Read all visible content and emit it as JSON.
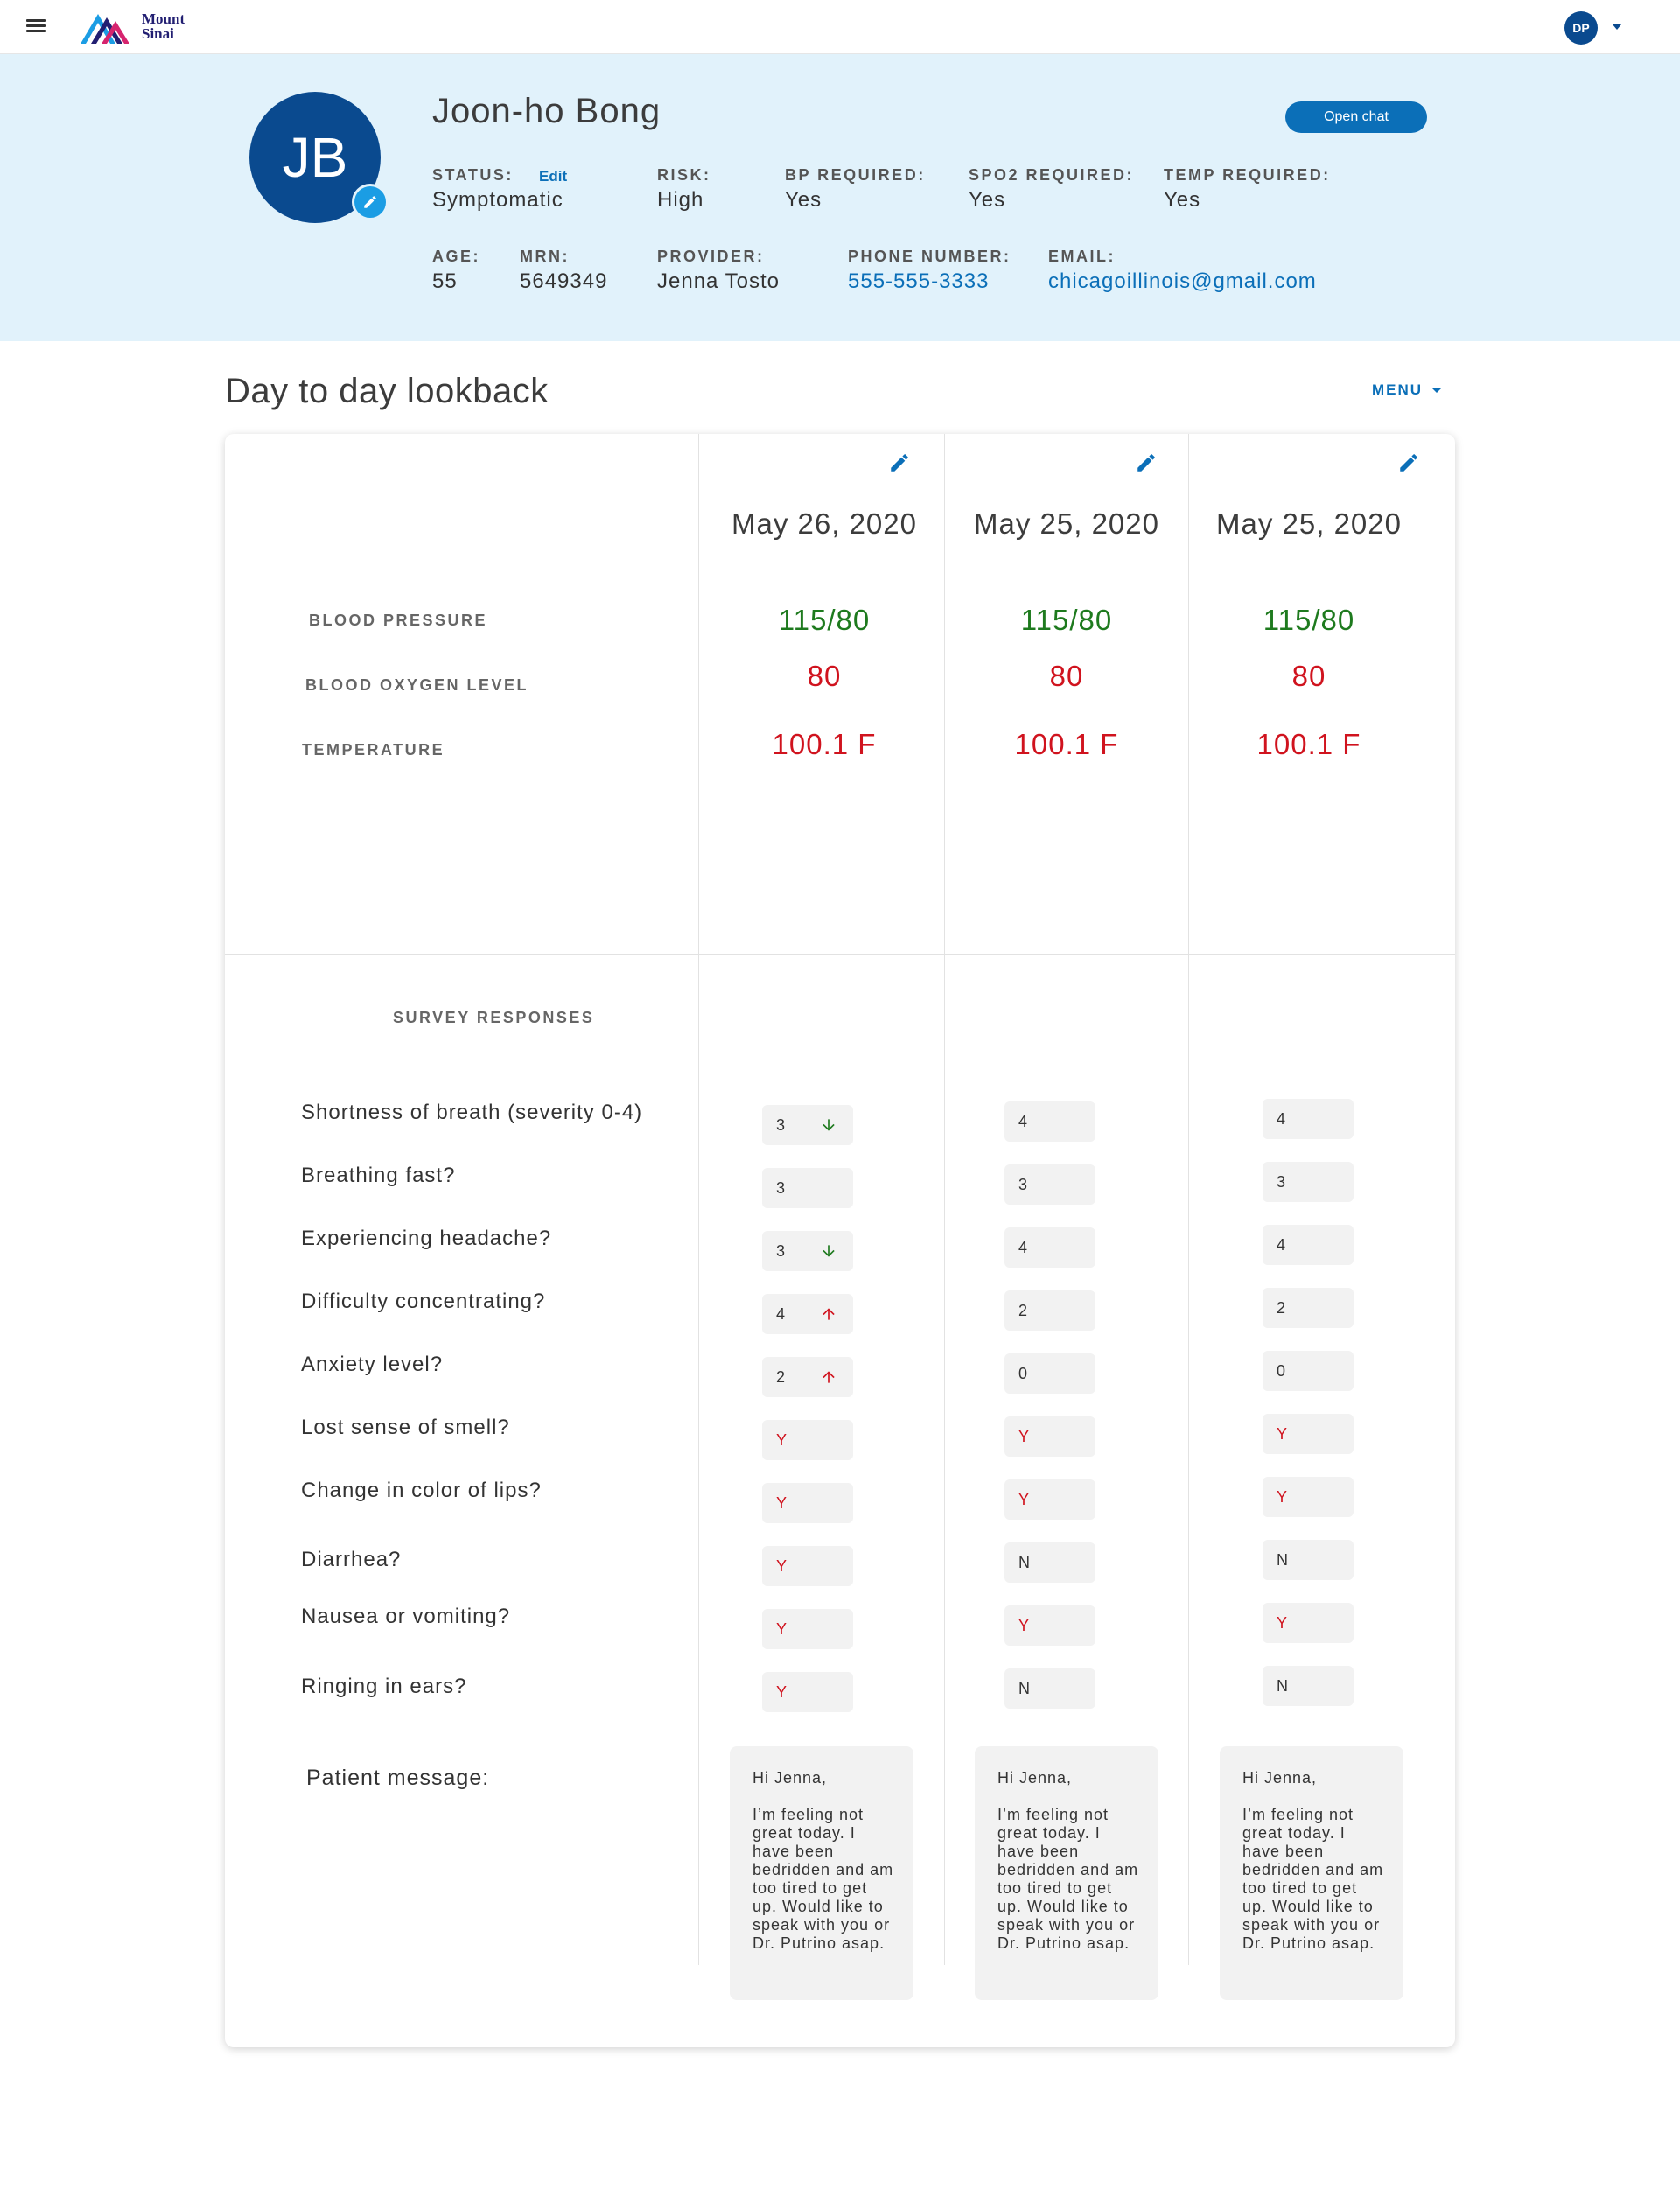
{
  "app": {
    "logo_line1": "Mount",
    "logo_line2": "Sinai",
    "user_initials": "DP"
  },
  "patient": {
    "initials": "JB",
    "name": "Joon-ho Bong",
    "open_chat_label": "Open chat",
    "edit_label": "Edit",
    "fields_row1": [
      {
        "label": "STATUS:",
        "value": "Symptomatic"
      },
      {
        "label": "RISK:",
        "value": "High"
      },
      {
        "label": "BP REQUIRED:",
        "value": "Yes"
      },
      {
        "label": "SPO2 REQUIRED:",
        "value": "Yes"
      },
      {
        "label": "TEMP REQUIRED:",
        "value": "Yes"
      }
    ],
    "fields_row2": [
      {
        "label": "AGE:",
        "value": "55"
      },
      {
        "label": "MRN:",
        "value": "5649349"
      },
      {
        "label": "PROVIDER:",
        "value": "Jenna Tosto"
      },
      {
        "label": "PHONE NUMBER:",
        "value": "555-555-3333"
      },
      {
        "label": "EMAIL:",
        "value": "chicagoillinois@gmail.com"
      }
    ]
  },
  "lookback": {
    "title": "Day to day lookback",
    "menu_label": "MENU",
    "vital_labels": [
      "BLOOD PRESSURE",
      "BLOOD OXYGEN LEVEL",
      "TEMPERATURE"
    ],
    "survey_title": "SURVEY RESPONSES",
    "questions": [
      "Shortness of breath (severity 0-4)",
      "Breathing fast?",
      "Experiencing headache?",
      "Difficulty concentrating?",
      "Anxiety level?",
      "Lost sense of smell?",
      "Change in color of lips?",
      "Diarrhea?",
      "Nausea or vomiting?",
      "Ringing in ears?"
    ],
    "message_label": "Patient message:",
    "days": [
      {
        "date": "May 26, 2020",
        "vitals": [
          "115/80",
          "80",
          "100.1 F"
        ],
        "responses": [
          "3",
          "3",
          "3",
          "4",
          "2",
          "Y",
          "Y",
          "Y",
          "Y",
          "Y"
        ],
        "trends": [
          "down",
          "",
          "down",
          "up",
          "up",
          "",
          "",
          "",
          "",
          ""
        ],
        "message": [
          "Hi Jenna,",
          "I’m feeling not great today. I have been bedridden and am too tired to get up. Would like to speak with you or Dr. Putrino asap."
        ]
      },
      {
        "date": "May 25, 2020",
        "vitals": [
          "115/80",
          "80",
          "100.1 F"
        ],
        "responses": [
          "4",
          "3",
          "4",
          "2",
          "0",
          "Y",
          "Y",
          "N",
          "Y",
          "N"
        ],
        "trends": [
          "",
          "",
          "",
          "",
          "",
          "",
          "",
          "",
          "",
          ""
        ],
        "message": [
          "Hi Jenna,",
          "I’m feeling not great today. I have been bedridden and am too tired to get up. Would like to speak with you or Dr. Putrino asap."
        ]
      },
      {
        "date": "May 25, 2020",
        "vitals": [
          "115/80",
          "80",
          "100.1 F"
        ],
        "responses": [
          "4",
          "3",
          "4",
          "2",
          "0",
          "Y",
          "Y",
          "N",
          "Y",
          "N"
        ],
        "trends": [
          "",
          "",
          "",
          "",
          "",
          "",
          "",
          "",
          "",
          ""
        ],
        "message": [
          "Hi Jenna,",
          "I’m feeling not great today. I have been bedridden and am too tired to get up. Would like to speak with you or Dr. Putrino asap."
        ]
      }
    ]
  },
  "colors": {
    "accent": "#0b6fb8",
    "brand": "#0a4a8f",
    "normal": "#1e7a1e",
    "alert": "#d0131e",
    "header_bg": "#e1f2fb"
  }
}
